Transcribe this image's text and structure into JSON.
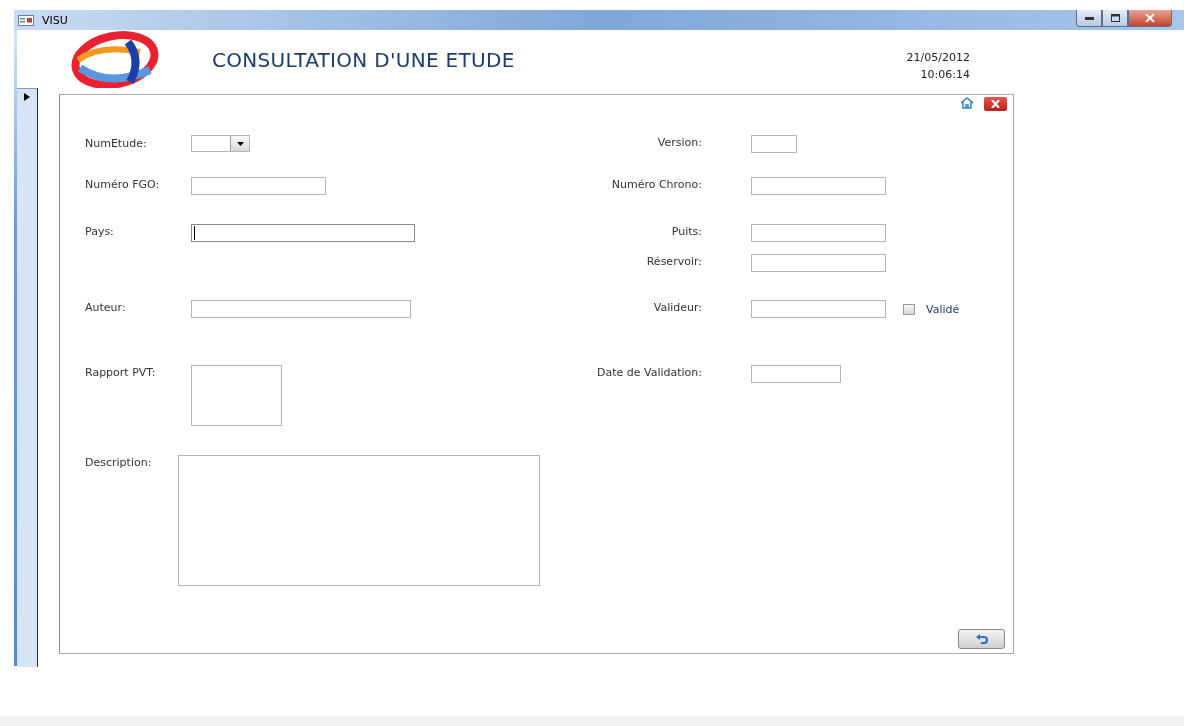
{
  "window": {
    "title": "VISU"
  },
  "header": {
    "title": "CONSULTATION D'UNE ETUDE",
    "date": "21/05/2012",
    "time": "10:06:14"
  },
  "rows": [
    {
      "left": {
        "label": "NumEtude:",
        "kind": "combo"
      },
      "right": {
        "label": "Version:",
        "kind": "short"
      }
    },
    {
      "left": {
        "label": "Numéro FGO:",
        "kind": "medium"
      },
      "right": {
        "label": "Numéro Chrono:",
        "kind": "medium"
      }
    },
    {
      "left": {
        "label": "Pays:",
        "kind": "wide",
        "focused": true
      },
      "right": {
        "label": "Puits:",
        "kind": "medium"
      }
    },
    {
      "right": {
        "label": "Réservoir:",
        "kind": "medium"
      }
    },
    {
      "left": {
        "label": "Auteur:",
        "kind": "wide",
        "focused": false
      },
      "right": {
        "label": "Valideur:",
        "kind": "medium",
        "checkbox": {
          "label": "Validé",
          "checked": false
        }
      }
    },
    {
      "left": {
        "label": "Rapport PVT:",
        "kind": "frame"
      },
      "right": {
        "label": "Date de Validation:",
        "kind": "date"
      }
    },
    {
      "left": {
        "label": "Description:",
        "kind": "memo"
      }
    }
  ]
}
